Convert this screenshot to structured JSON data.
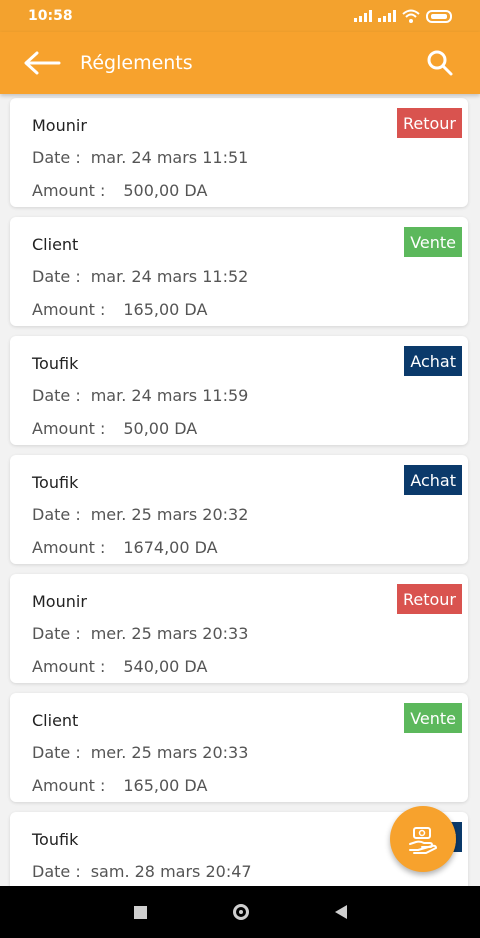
{
  "status_bar": {
    "time": "10:58"
  },
  "app_bar": {
    "title": "Réglements"
  },
  "labels": {
    "date": "Date :",
    "amount": "Amount :"
  },
  "colors": {
    "primary": "#f7a22d",
    "retour": "#d9534f",
    "vente": "#5cb85c",
    "achat": "#0b3a6b"
  },
  "payments": [
    {
      "name": "Mounir",
      "type": "Retour",
      "date": "mar. 24 mars 11:51",
      "amount": "500,00 DA"
    },
    {
      "name": "Client",
      "type": "Vente",
      "date": "mar. 24 mars 11:52",
      "amount": "165,00 DA"
    },
    {
      "name": "Toufik",
      "type": "Achat",
      "date": "mar. 24 mars 11:59",
      "amount": "50,00 DA"
    },
    {
      "name": "Toufik",
      "type": "Achat",
      "date": "mer. 25 mars 20:32",
      "amount": "1674,00 DA"
    },
    {
      "name": "Mounir",
      "type": "Retour",
      "date": "mer. 25 mars 20:33",
      "amount": "540,00 DA"
    },
    {
      "name": "Client",
      "type": "Vente",
      "date": "mer. 25 mars 20:33",
      "amount": "165,00 DA"
    },
    {
      "name": "Toufik",
      "type": "Achat",
      "date": "sam. 28 mars 20:47",
      "amount": ""
    }
  ],
  "icons": {
    "back": "arrow-left-icon",
    "search": "search-icon",
    "fab": "payment-hand-icon"
  }
}
